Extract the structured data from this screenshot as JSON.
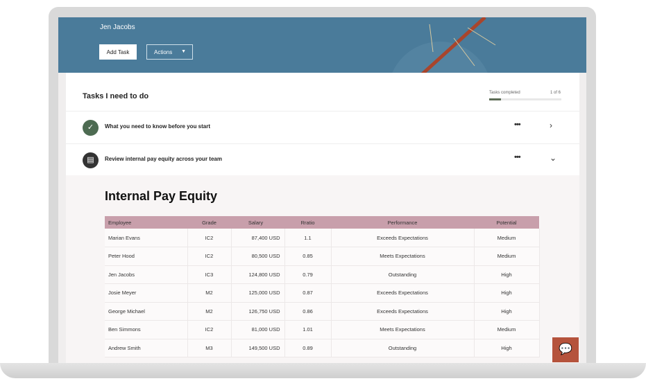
{
  "header": {
    "user_name": "Jen Jacobs",
    "add_task_label": "Add Task",
    "actions_label": "Actions"
  },
  "tasks": {
    "title": "Tasks I need to do",
    "progress_label": "Tasks completed",
    "progress_count": "1 of 6",
    "progress_fraction": 0.167,
    "items": [
      {
        "label": "What you need to know before you start",
        "status": "completed"
      },
      {
        "label": "Review internal pay equity across your team",
        "status": "expanded"
      }
    ]
  },
  "section": {
    "title": "Internal Pay Equity"
  },
  "table": {
    "columns": [
      "Employee",
      "Grade",
      "Salary",
      "Rratio",
      "Performance",
      "Potential"
    ],
    "rows": [
      [
        "Marian Evans",
        "IC2",
        "87,400 USD",
        "1.1",
        "Exceeds Expectations",
        "Medium"
      ],
      [
        "Peter Hood",
        "IC2",
        "80,500 USD",
        "0.85",
        "Meets Expectations",
        "Medium"
      ],
      [
        "Jen Jacobs",
        "IC3",
        "124,800 USD",
        "0.79",
        "Outstanding",
        "High"
      ],
      [
        "Josie Meyer",
        "M2",
        "125,000 USD",
        "0.87",
        "Exceeds Expectations",
        "High"
      ],
      [
        "George Michael",
        "M2",
        "126,750 USD",
        "0.86",
        "Exceeds Expectations",
        "High"
      ],
      [
        "Ben Simmons",
        "IC2",
        "81,000 USD",
        "1.01",
        "Meets Expectations",
        "Medium"
      ],
      [
        "Andrew Smith",
        "M3",
        "149,500 USD",
        "0.89",
        "Outstanding",
        "High"
      ]
    ]
  },
  "colors": {
    "header": "#4a7b9a",
    "table_header": "#c89fab",
    "chat": "#b5533c",
    "check": "#4d6b52"
  }
}
